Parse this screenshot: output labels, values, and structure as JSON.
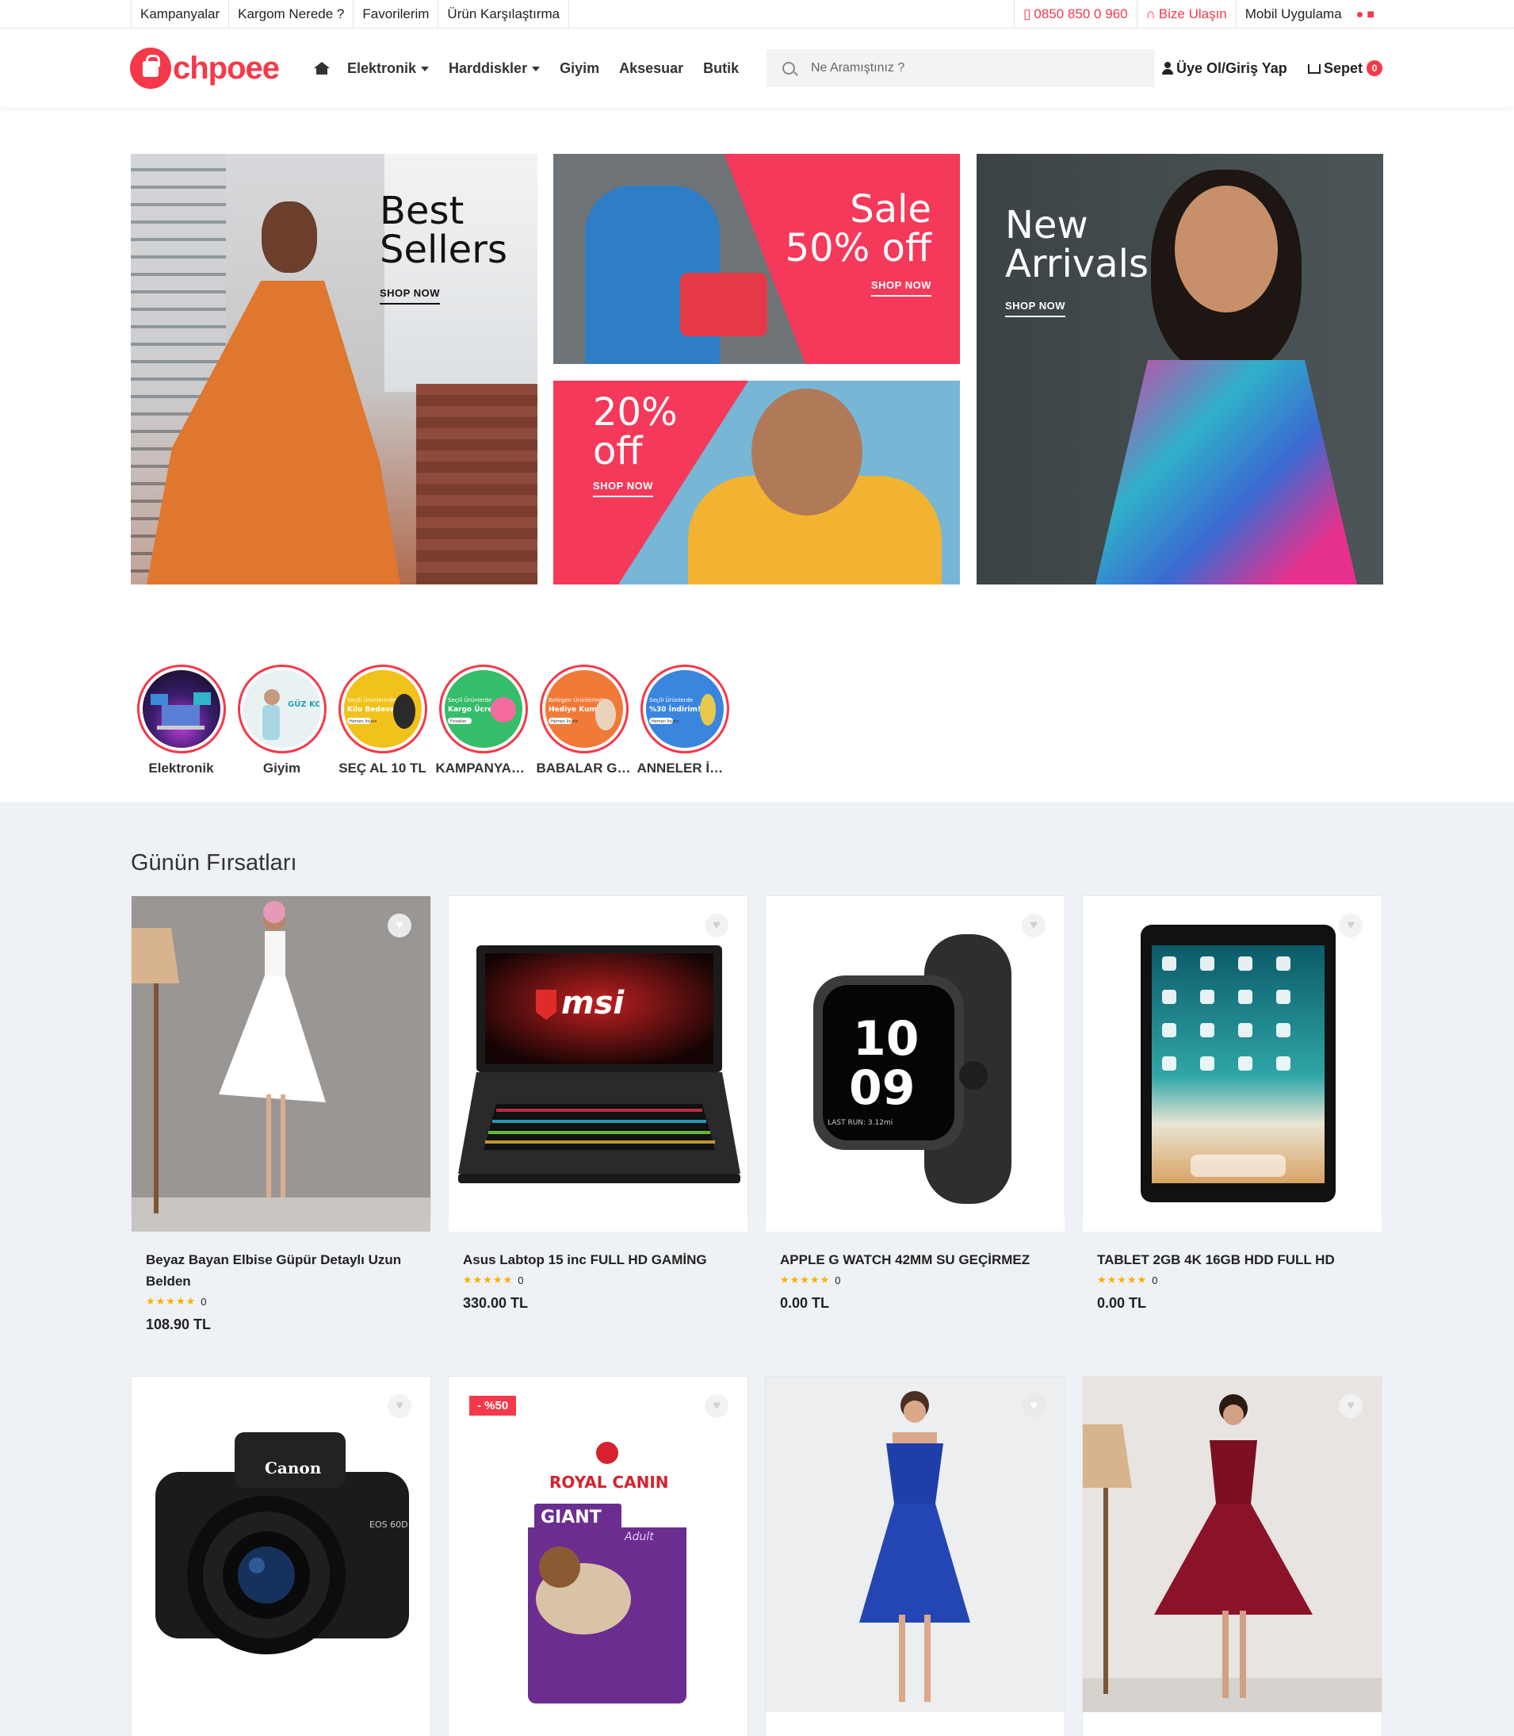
{
  "topbar": {
    "left": [
      "Kampanyalar",
      "Kargom Nerede ?",
      "Favorilerim",
      "Ürün Karşılaştırma"
    ],
    "phone": "0850 850 0 960",
    "contact": "Bize Ulaşın",
    "mobile": "Mobil Uygulama"
  },
  "header": {
    "logo_text": "chpoee",
    "nav": [
      "Elektronik",
      "Harddiskler",
      "Giyim",
      "Aksesuar",
      "Butik"
    ],
    "search_placeholder": "Ne Aramıştınız ?",
    "login": "Üye Ol/Giriş Yap",
    "cart": "Sepet",
    "cart_count": "0"
  },
  "banners": {
    "best": {
      "title_1": "Best",
      "title_2": "Sellers",
      "cta": "SHOP NOW"
    },
    "sale": {
      "title_1": "Sale",
      "title_2": "50% off",
      "cta": "SHOP NOW"
    },
    "off20": {
      "title_1": "20%",
      "title_2": "off",
      "cta": "SHOP NOW"
    },
    "arrivals": {
      "title_1": "New",
      "title_2": "Arrivals",
      "cta": "SHOP NOW"
    }
  },
  "stories": [
    "Elektronik",
    "Giyim",
    "SEÇ AL 10 TL",
    "KAMPANYALAR",
    "BABALAR GÜNÜ",
    "ANNELER İÇİN"
  ],
  "story_art": {
    "giyim": "GÜZ KOL",
    "sec": [
      "Seçili Ürünlerinde",
      "Kilo Bedava",
      "Hemen İncele"
    ],
    "kamp": [
      "Seçili Ürünlerde",
      "Kargo Ücretsiz!",
      "Fırsatlar"
    ],
    "babalar": [
      "Belirgen Ürünlerinde",
      "Hediye Kum!",
      "Hemen İncele"
    ],
    "anneler": [
      "Seçili Ürünlerde",
      "%30 İndirim!",
      "Hemen İncele"
    ]
  },
  "deals": {
    "title": "Günün Fırsatları",
    "products": [
      {
        "name": "Beyaz Bayan Elbise Güpür Detaylı Uzun Belden",
        "reviews": "0",
        "price": "108.90 TL"
      },
      {
        "name": "Asus Labtop 15 inc FULL HD GAMİNG",
        "reviews": "0",
        "price": "330.00 TL"
      },
      {
        "name": "APPLE G WATCH 42MM SU GEÇİRMEZ",
        "reviews": "0",
        "price": "0.00 TL"
      },
      {
        "name": "TABLET 2GB 4K 16GB HDD FULL HD",
        "reviews": "0",
        "price": "0.00 TL"
      },
      {
        "name": "",
        "reviews": "",
        "price": ""
      },
      {
        "name": "",
        "reviews": "",
        "price": "",
        "discount": "- %50"
      },
      {
        "name": "",
        "reviews": "",
        "price": ""
      },
      {
        "name": "",
        "reviews": "",
        "price": ""
      }
    ],
    "art": {
      "msi": "msi",
      "watch_hour": "10",
      "watch_min": "09",
      "watch_sub": "LAST RUN: 3.12mi",
      "canon": "Canon",
      "canon_model": "EOS 60D",
      "royal": "ROYAL CANIN",
      "giant": "GIANT",
      "adult": "Adult"
    }
  },
  "colors": {
    "accent": "#f5394a",
    "deals_bg": "#eef1f5",
    "star": "#f5b301"
  }
}
